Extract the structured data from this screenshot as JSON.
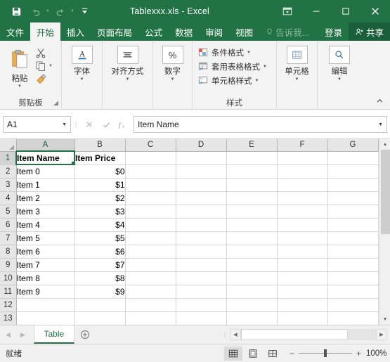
{
  "titlebar": {
    "document_title": "Tablexxx.xls - Excel",
    "quick_access": [
      {
        "name": "save",
        "icon": "save-icon"
      },
      {
        "name": "undo",
        "icon": "undo-icon"
      },
      {
        "name": "redo",
        "icon": "redo-icon"
      },
      {
        "name": "customize-quick-access-toolbar",
        "icon": "caret-down-icon"
      }
    ],
    "window_controls": [
      {
        "name": "ribbon-display-options",
        "icon": "ribbon-options-icon"
      },
      {
        "name": "minimize",
        "label": "‒"
      },
      {
        "name": "maximize",
        "label": "□"
      },
      {
        "name": "close",
        "label": "✕"
      }
    ]
  },
  "tabs": [
    {
      "id": "file",
      "label": "文件",
      "active": false
    },
    {
      "id": "home",
      "label": "开始",
      "active": true
    },
    {
      "id": "insert",
      "label": "插入",
      "active": false
    },
    {
      "id": "page-layout",
      "label": "页面布局",
      "active": false
    },
    {
      "id": "formulas",
      "label": "公式",
      "active": false
    },
    {
      "id": "data",
      "label": "数据",
      "active": false
    },
    {
      "id": "review",
      "label": "审阅",
      "active": false
    },
    {
      "id": "view",
      "label": "视图",
      "active": false
    }
  ],
  "tellme": {
    "label": "告诉我..."
  },
  "signin": {
    "label": "登录"
  },
  "share": {
    "label": "共享"
  },
  "ribbon": {
    "clipboard": {
      "group_label": "剪贴板",
      "paste_label": "粘贴",
      "tools": [
        {
          "name": "cut",
          "icon": "scissors-icon"
        },
        {
          "name": "copy",
          "icon": "copy-icon"
        },
        {
          "name": "format-painter",
          "icon": "format-painter-icon"
        }
      ]
    },
    "font": {
      "group_label": "字体",
      "glyph": "A"
    },
    "alignment": {
      "group_label": "对齐方式",
      "glyph": "align-center-icon"
    },
    "number": {
      "group_label": "数字",
      "glyph": "%"
    },
    "styles": {
      "group_label": "样式",
      "items": [
        {
          "name": "conditional-formatting",
          "label": "条件格式"
        },
        {
          "name": "format-as-table",
          "label": "套用表格格式"
        },
        {
          "name": "cell-styles",
          "label": "单元格样式"
        }
      ]
    },
    "cells": {
      "group_label": "单元格",
      "label": "单元格"
    },
    "editing": {
      "group_label": "编辑",
      "label": "编辑"
    }
  },
  "formula_bar": {
    "name_box_value": "A1",
    "cancel_icon": "cancel-icon",
    "enter_icon": "check-icon",
    "function_icon": "fx-icon",
    "formula_value": "Item Name"
  },
  "grid": {
    "columns": [
      "A",
      "B",
      "C",
      "D",
      "E",
      "F",
      "G"
    ],
    "selected_column": "A",
    "selected_row": 1,
    "active_cell": "A1",
    "rows": [
      {
        "num": 1,
        "cells": [
          "Item Name",
          "Item Price",
          "",
          "",
          "",
          "",
          ""
        ]
      },
      {
        "num": 2,
        "cells": [
          "Item 0",
          "$0",
          "",
          "",
          "",
          "",
          ""
        ]
      },
      {
        "num": 3,
        "cells": [
          "Item 1",
          "$1",
          "",
          "",
          "",
          "",
          ""
        ]
      },
      {
        "num": 4,
        "cells": [
          "Item 2",
          "$2",
          "",
          "",
          "",
          "",
          ""
        ]
      },
      {
        "num": 5,
        "cells": [
          "Item 3",
          "$3",
          "",
          "",
          "",
          "",
          ""
        ]
      },
      {
        "num": 6,
        "cells": [
          "Item 4",
          "$4",
          "",
          "",
          "",
          "",
          ""
        ]
      },
      {
        "num": 7,
        "cells": [
          "Item 5",
          "$5",
          "",
          "",
          "",
          "",
          ""
        ]
      },
      {
        "num": 8,
        "cells": [
          "Item 6",
          "$6",
          "",
          "",
          "",
          "",
          ""
        ]
      },
      {
        "num": 9,
        "cells": [
          "Item 7",
          "$7",
          "",
          "",
          "",
          "",
          ""
        ]
      },
      {
        "num": 10,
        "cells": [
          "Item 8",
          "$8",
          "",
          "",
          "",
          "",
          ""
        ]
      },
      {
        "num": 11,
        "cells": [
          "Item 9",
          "$9",
          "",
          "",
          "",
          "",
          ""
        ]
      },
      {
        "num": 12,
        "cells": [
          "",
          "",
          "",
          "",
          "",
          "",
          ""
        ]
      },
      {
        "num": 13,
        "cells": [
          "",
          "",
          "",
          "",
          "",
          "",
          ""
        ]
      }
    ]
  },
  "sheet_tabs": {
    "tabs": [
      {
        "name": "table",
        "label": "Table",
        "active": true
      }
    ],
    "add_sheet_icon": "plus-circle-icon",
    "prev_icon": "triangle-left-icon",
    "next_icon": "triangle-right-icon"
  },
  "statusbar": {
    "status_text": "就绪",
    "views": [
      {
        "name": "normal-view",
        "icon": "grid-icon",
        "active": true
      },
      {
        "name": "page-layout-view",
        "icon": "page-icon",
        "active": false
      },
      {
        "name": "page-break-view",
        "icon": "page-break-icon",
        "active": false
      }
    ],
    "zoom_out_label": "−",
    "zoom_in_label": "+",
    "zoom_level": "100%"
  },
  "colors": {
    "excel_green": "#217346",
    "share_green": "#1b5e3a",
    "ribbon_bg": "#f3f3f3",
    "grid_line": "#d6d6d6"
  }
}
